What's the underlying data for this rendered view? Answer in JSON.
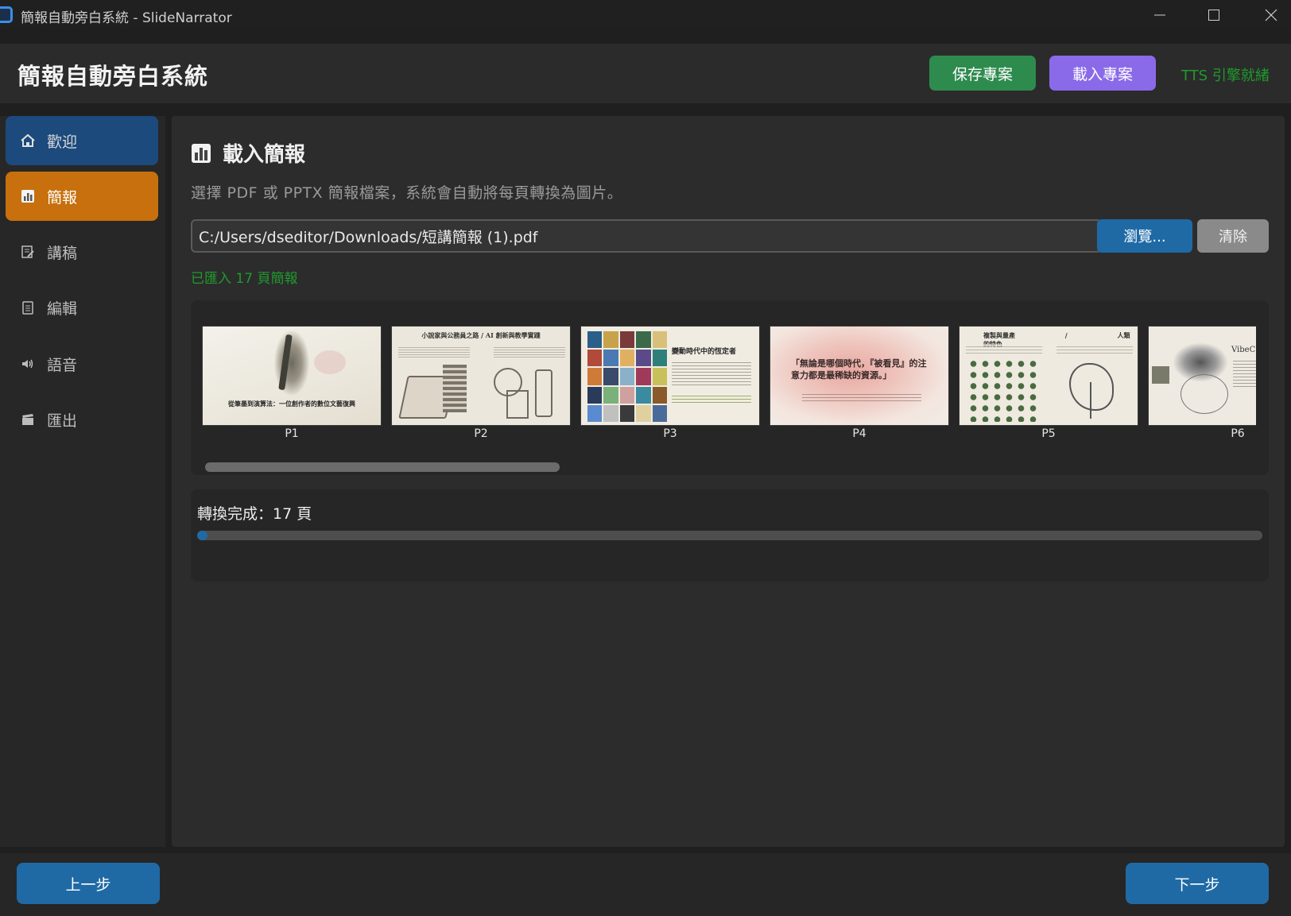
{
  "window": {
    "title": "簡報自動旁白系統 - SlideNarrator",
    "controls": [
      "minimize-icon",
      "maximize-icon",
      "close-icon"
    ]
  },
  "header": {
    "title": "簡報自動旁白系統",
    "save_label": "保存專案",
    "load_label": "載入專案",
    "tts_status": "TTS 引擎就緒"
  },
  "sidebar": {
    "items": [
      {
        "label": "歡迎",
        "icon": "home-icon"
      },
      {
        "label": "簡報",
        "icon": "bar-chart-icon"
      },
      {
        "label": "講稿",
        "icon": "script-edit-icon"
      },
      {
        "label": "編輯",
        "icon": "notepad-icon"
      },
      {
        "label": "語音",
        "icon": "speaker-icon"
      },
      {
        "label": "匯出",
        "icon": "clapperboard-icon"
      }
    ]
  },
  "main": {
    "title": "載入簡報",
    "description": "選擇 PDF 或 PPTX 簡報檔案，系統會自動將每頁轉換為圖片。",
    "file_path": "C:/Users/dseditor/Downloads/短講簡報 (1).pdf",
    "browse_label": "瀏覽...",
    "clear_label": "清除",
    "import_status": "已匯入 17 頁簡報",
    "thumbnails": [
      {
        "caption": "P1",
        "text": "從筆墨到演算法：一位創作者的數位文藝復興"
      },
      {
        "caption": "P2",
        "text": "小說家與公務員之路 / AI 創新與教學實踐"
      },
      {
        "caption": "P3",
        "text": "變動時代中的恆定者"
      },
      {
        "caption": "P4",
        "text": "「無論是哪個時代，『被看見』的注意力都是最稀缺的資源。」"
      },
      {
        "caption": "P5",
        "text": "複製與量產 / 人類的特色"
      },
      {
        "caption": "P6",
        "text": "VibeC"
      }
    ],
    "progress": {
      "label": "轉換完成：17 頁",
      "fraction": 0.01
    }
  },
  "footer": {
    "prev_label": "上一步",
    "next_label": "下一步"
  },
  "colors": {
    "accent_blue": "#1f6aa5",
    "active_orange": "#c7700d",
    "save_green": "#2e8b4e",
    "load_purple": "#8a6ae8",
    "status_green": "#1f9a2c"
  }
}
